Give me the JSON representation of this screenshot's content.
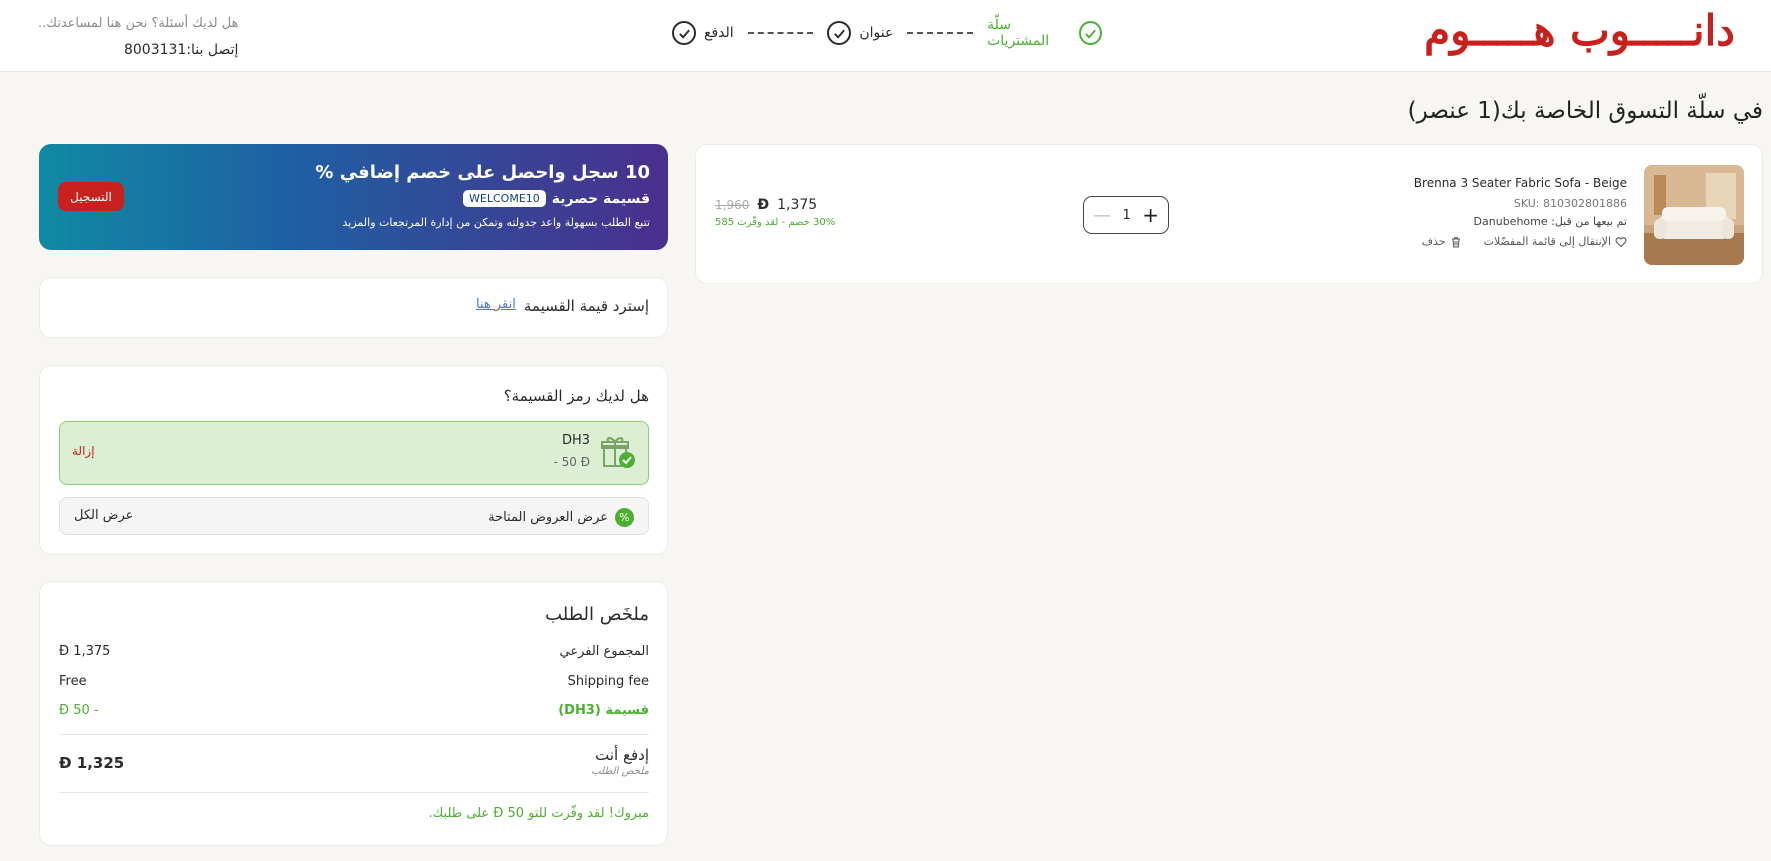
{
  "header": {
    "logo": "دانـــــوب هـــــوم",
    "steps": [
      {
        "label": "سلّة المشتريات",
        "done": true
      },
      {
        "label": "عنوان",
        "done": false
      },
      {
        "label": "الدفع",
        "done": false
      }
    ],
    "help_text": "هل لديك أسئلة؟ نحن هنا لمساعدتك..",
    "phone_text": "إتصل بنا:8003131"
  },
  "page_title": "في سلّة التسوق الخاصة بك(1 عنصر)",
  "cart_item": {
    "name": "Brenna 3 Seater Fabric Sofa - Beige",
    "sku": "SKU: 810302801886",
    "seller": "تم بيعها من قبل: Danubehome",
    "wishlist": "الإنتقال إلى قائمة المفضّلات",
    "delete": "حذف",
    "quantity": "1",
    "price": "1,375",
    "old_price": "1,960",
    "saving": "30% خصم - لقد وفّرت 585",
    "currency_symbol": "Đ"
  },
  "promo": {
    "title": "10 سجل واحصل على خصم إضافي %",
    "subtitle": "قسيمة حصرية",
    "code": "WELCOME10",
    "desc": "تتبع الطلب بسهولة واعد جدولته وتمكن من إدارة المرتجعات والمزيد",
    "button": "التسجيل"
  },
  "redeem": {
    "text": "إسترد قيمة القسيمة",
    "link": "انقر هنا"
  },
  "coupon": {
    "question": "هل لديك رمز القسيمة؟",
    "applied_name": "DH3",
    "applied_amount": "- 50 Đ",
    "remove": "إزالة",
    "offers_label": "عرض العروض المتاحة",
    "view_all": "عرض الكل",
    "offers_icon": "percent-badge-icon"
  },
  "summary": {
    "title": "ملخَص الطلب",
    "rows": [
      {
        "label": "المجموع الفرعي",
        "value": "Đ 1,375"
      },
      {
        "label": "Shipping fee",
        "value": "Free"
      },
      {
        "label": "قسيمة (DH3)",
        "value": "Đ 50 -"
      }
    ],
    "total_label": "إدفع أنت",
    "total_sub": "ملخص الطلب",
    "total_value": "Đ 1,325",
    "congrats": "مبروك! لقد وفّرت للتو 50 Đ على طلبك."
  },
  "colors": {
    "brand": "#c8201c",
    "success": "#4caf32",
    "link": "#3a7bd5"
  }
}
